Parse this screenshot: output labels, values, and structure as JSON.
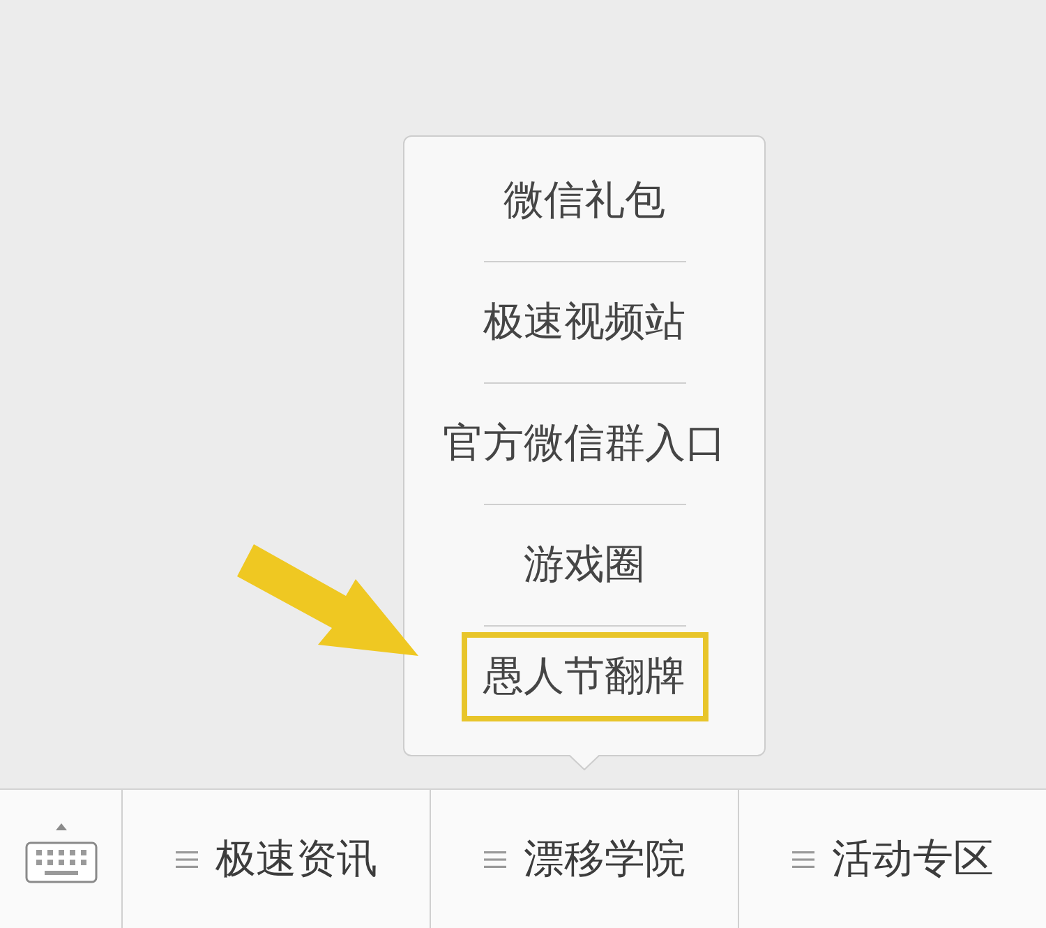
{
  "menu_bar": {
    "items": [
      {
        "label": "极速资讯"
      },
      {
        "label": "漂移学院",
        "submenu": [
          {
            "label": "微信礼包",
            "highlighted": false
          },
          {
            "label": "极速视频站",
            "highlighted": false
          },
          {
            "label": "官方微信群入口",
            "highlighted": false
          },
          {
            "label": "游戏圈",
            "highlighted": false
          },
          {
            "label": "愚人节翻牌",
            "highlighted": true
          }
        ]
      },
      {
        "label": "活动专区"
      }
    ]
  }
}
